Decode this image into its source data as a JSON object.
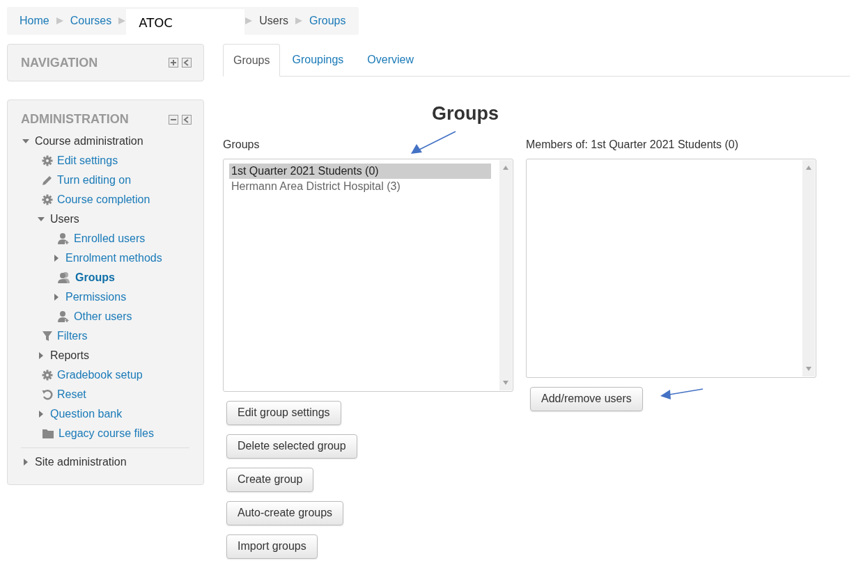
{
  "breadcrumb": [
    {
      "label": "Home",
      "kind": "link"
    },
    {
      "label": "Courses",
      "kind": "link"
    },
    {
      "label": "ATOC",
      "kind": "overlay"
    },
    {
      "label": "Users",
      "kind": "plain"
    },
    {
      "label": "Groups",
      "kind": "link"
    }
  ],
  "navigation_block": {
    "title": "NAVIGATION"
  },
  "administration_block": {
    "title": "ADMINISTRATION",
    "items": [
      {
        "label": "Course administration",
        "kind": "branch",
        "expanded": true,
        "children": [
          {
            "label": "Edit settings",
            "kind": "gear",
            "selected": false
          },
          {
            "label": "Turn editing on",
            "kind": "pencil",
            "selected": false
          },
          {
            "label": "Course completion",
            "kind": "gear",
            "selected": false
          },
          {
            "label": "Users",
            "kind": "branch",
            "expanded": true,
            "children": [
              {
                "label": "Enrolled users",
                "kind": "user",
                "selected": false
              },
              {
                "label": "Enrolment methods",
                "kind": "link-branch",
                "expanded": false
              },
              {
                "label": "Groups",
                "kind": "users",
                "selected": true
              },
              {
                "label": "Permissions",
                "kind": "link-branch",
                "expanded": false
              },
              {
                "label": "Other users",
                "kind": "user",
                "selected": false
              }
            ]
          },
          {
            "label": "Filters",
            "kind": "funnel",
            "selected": false
          },
          {
            "label": "Reports",
            "kind": "branch",
            "expanded": false
          },
          {
            "label": "Gradebook setup",
            "kind": "gear",
            "selected": false
          },
          {
            "label": "Reset",
            "kind": "reset",
            "selected": false
          },
          {
            "label": "Question bank",
            "kind": "link-branch",
            "expanded": false
          },
          {
            "label": "Legacy course files",
            "kind": "folder",
            "selected": false
          }
        ]
      },
      {
        "label": "Site administration",
        "kind": "branch",
        "expanded": false
      }
    ]
  },
  "tabs": [
    {
      "label": "Groups",
      "selected": true
    },
    {
      "label": "Groupings",
      "selected": false
    },
    {
      "label": "Overview",
      "selected": false
    }
  ],
  "heading": "Groups",
  "groups_list": {
    "label": "Groups",
    "options": [
      {
        "label": "1st Quarter 2021 Students (0)",
        "selected": true
      },
      {
        "label": "Hermann Area District Hospital (3)",
        "selected": false
      }
    ]
  },
  "members_list": {
    "label": "Members of: 1st Quarter 2021 Students (0)"
  },
  "group_buttons": [
    "Edit group settings",
    "Delete selected group",
    "Create group",
    "Auto-create groups",
    "Import groups"
  ],
  "members_button": "Add/remove users"
}
